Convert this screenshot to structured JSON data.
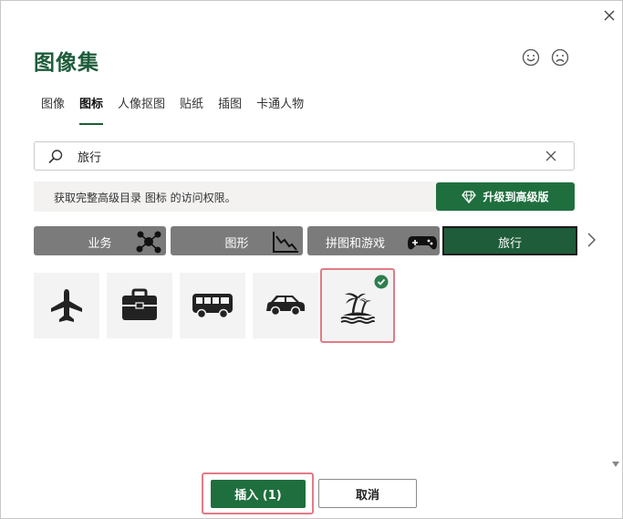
{
  "dialog": {
    "title": "图像集",
    "close_icon": "close-icon",
    "feedback": {
      "happy_icon": "smiley-icon",
      "sad_icon": "frown-icon"
    }
  },
  "tabs": [
    {
      "label": "图像",
      "active": false
    },
    {
      "label": "图标",
      "active": true
    },
    {
      "label": "人像抠图",
      "active": false
    },
    {
      "label": "贴纸",
      "active": false
    },
    {
      "label": "插图",
      "active": false
    },
    {
      "label": "卡通人物",
      "active": false
    }
  ],
  "search": {
    "value": "旅行",
    "placeholder": "",
    "search_icon": "search-icon",
    "clear_icon": "clear-icon"
  },
  "banner": {
    "message": "获取完整高级目录 图标 的访问权限。",
    "upgrade_label": "升级到高级版",
    "upgrade_icon": "diamond-icon"
  },
  "categories": [
    {
      "label": "业务",
      "icon": "network-icon",
      "active": false
    },
    {
      "label": "图形",
      "icon": "chart-icon",
      "active": false
    },
    {
      "label": "拼图和游戏",
      "icon": "gamepad-icon",
      "active": false
    },
    {
      "label": "旅行",
      "icon": "",
      "active": true
    }
  ],
  "results": [
    {
      "icon": "airplane-icon",
      "selected": false
    },
    {
      "icon": "briefcase-icon",
      "selected": false
    },
    {
      "icon": "bus-icon",
      "selected": false
    },
    {
      "icon": "car-icon",
      "selected": false
    },
    {
      "icon": "island-icon",
      "selected": true
    }
  ],
  "footer": {
    "insert_label": "插入 (1)",
    "cancel_label": "取消"
  },
  "colors": {
    "accent": "#1f6f3e",
    "title": "#1e5c3a",
    "category_bg": "#7b7b7b",
    "selection_outline": "#e37b87",
    "check": "#2e7d4f"
  }
}
